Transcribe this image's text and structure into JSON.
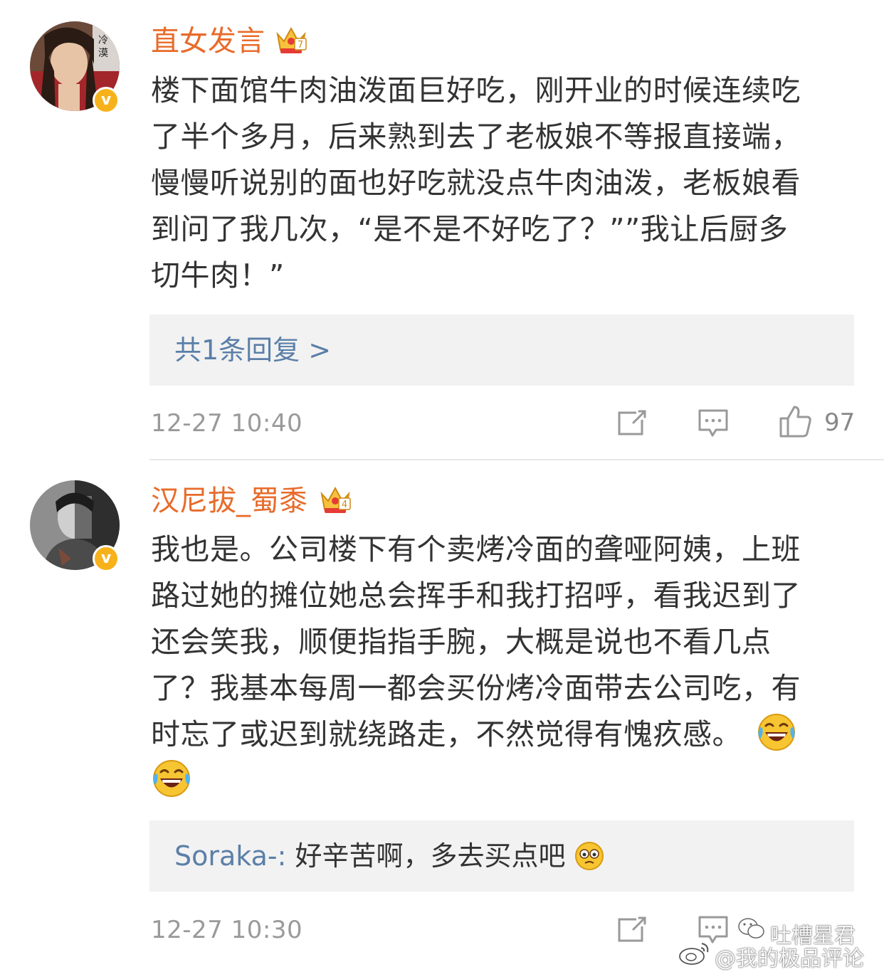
{
  "comments": [
    {
      "username": "直女发言",
      "avatar_caption": "冷漠",
      "text_lines": [
        "楼下面馆牛肉油泼面巨好吃，刚开业的时候连续吃",
        "了半个多月，后来熟到去了老板娘不等报直接端，",
        "慢慢听说别的面也好吃就没点牛肉油泼，老板娘看",
        "到问了我几次，“是不是不好吃了？””我让后厨多",
        "切牛肉！”"
      ],
      "reply_link": "共1条回复 >",
      "timestamp": "12-27 10:40",
      "likes": "97"
    },
    {
      "username": "汉尼拔_蜀黍",
      "text_lines": [
        "我也是。公司楼下有个卖烤冷面的聋哑阿姨，上班",
        "路过她的摊位她总会挥手和我打招呼，看我迟到了",
        "还会笑我，顺便指指手腕，大概是说也不看几点",
        "了？我基本每周一都会买份烤冷面带去公司吃，有",
        "时忘了或迟到就绕路走，不然觉得有愧疚感。"
      ],
      "reply_user": "Soraka-:",
      "reply_text": " 好辛苦啊，多去买点吧",
      "timestamp": "12-27 10:30"
    }
  ],
  "watermark": {
    "line1": "吐槽星君",
    "line2": "@我的极品评论"
  },
  "icons": [
    "vip-crown-icon",
    "verified-v-icon",
    "repost-icon",
    "comment-icon",
    "thumbs-up-icon",
    "laugh-cry-emoji",
    "weibo-logo-icon"
  ],
  "colors": {
    "username": "#e86b2a",
    "link": "#5b7fa8",
    "badge": "#f7b21b",
    "reply_bg": "#f2f2f2"
  }
}
